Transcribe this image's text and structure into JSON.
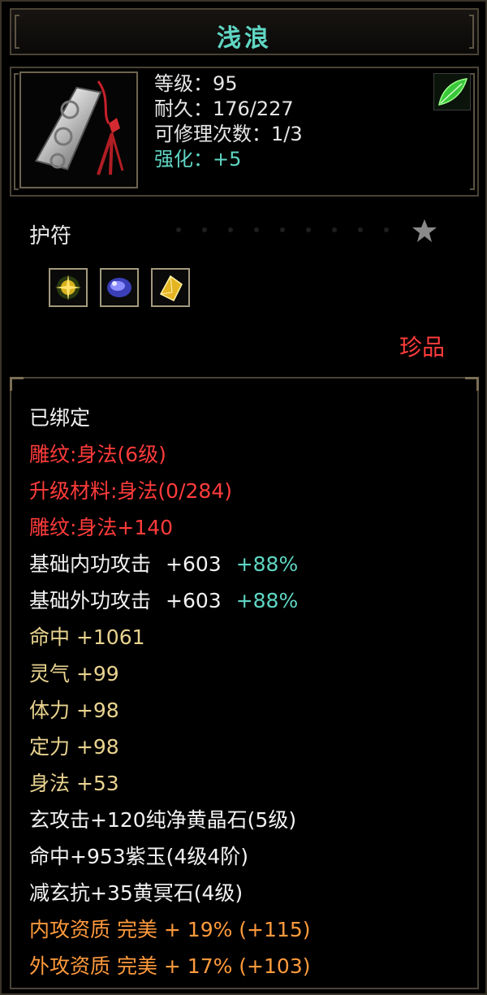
{
  "title": "浅浪",
  "header": {
    "level_label": "等级：95",
    "durability_label": "耐久：176/227",
    "repair_label": "可修理次数：1/3",
    "enhance_label": "强化：+5"
  },
  "category": "护符",
  "rarity": "珍品",
  "gems": [
    "gold-gem-icon",
    "purple-gem-icon",
    "yellow-gem-icon"
  ],
  "attributes": {
    "bound": "已绑定",
    "engrave_1": "雕纹:身法(6级)",
    "upgrade_material": "升级材料:身法(0/284)",
    "engrave_2": "雕纹:身法+140",
    "inner_attack_label": "基础内功攻击",
    "inner_attack_value": "+603",
    "inner_attack_bonus": "+88%",
    "outer_attack_label": "基础外功攻击",
    "outer_attack_value": "+603",
    "outer_attack_bonus": "+88%",
    "hit": "命中  +1061",
    "spirit": "灵气  +99",
    "stamina": "体力  +98",
    "focus": "定力  +98",
    "agility": "身法  +53",
    "socket_1": "玄攻击+120纯净黄晶石(5级)",
    "socket_2": "命中+953紫玉(4级4阶)",
    "socket_3": "减玄抗+35黄冥石(4级)",
    "inner_quality": "内攻资质  完美  +  19% (+115)",
    "outer_quality": "外攻资质  完美  +  17% (+103)"
  },
  "colors": {
    "title": "#5fd6c3",
    "rarity": "#ff3b3b",
    "engrave": "#ff3b3b",
    "stat": "#e9d38f",
    "quality": "#ff9a3c",
    "bonus": "#5fd6c3"
  }
}
